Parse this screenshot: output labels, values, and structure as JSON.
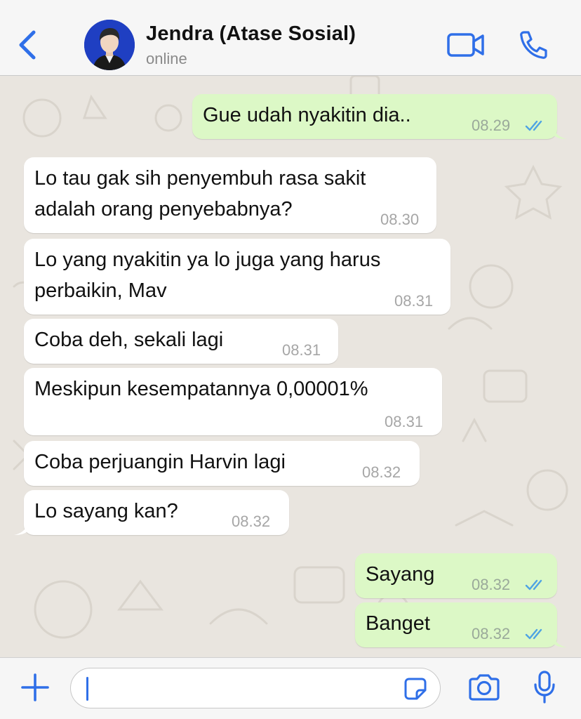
{
  "header": {
    "contact_name": "Jendra (Atase Sosial)",
    "contact_status": "online",
    "icons": {
      "back": "chevron-left-icon",
      "video": "video-camera-icon",
      "call": "phone-icon"
    },
    "accent_color": "#2f6fe8"
  },
  "messages": [
    {
      "direction": "outgoing",
      "lines": [
        "Gue udah nyakitin dia.."
      ],
      "time": "08.29",
      "status": "read"
    },
    {
      "direction": "incoming",
      "lines": [
        "Lo tau gak sih penyembuh rasa sakit",
        "adalah orang penyebabnya?"
      ],
      "time": "08.30"
    },
    {
      "direction": "incoming",
      "lines": [
        "Lo yang nyakitin ya lo juga yang harus",
        "perbaikin, Mav"
      ],
      "time": "08.31"
    },
    {
      "direction": "incoming",
      "lines": [
        "Coba deh, sekali lagi"
      ],
      "time": "08.31"
    },
    {
      "direction": "incoming",
      "lines": [
        "Meskipun kesempatannya 0,00001%"
      ],
      "time": "08.31"
    },
    {
      "direction": "incoming",
      "lines": [
        "Coba perjuangin Harvin lagi"
      ],
      "time": "08.32"
    },
    {
      "direction": "incoming",
      "lines": [
        "Lo sayang kan?"
      ],
      "time": "08.32"
    },
    {
      "direction": "outgoing",
      "lines": [
        "Sayang"
      ],
      "time": "08.32",
      "status": "read"
    },
    {
      "direction": "outgoing",
      "lines": [
        "Banget"
      ],
      "time": "08.32",
      "status": "read"
    }
  ],
  "composer": {
    "value": "",
    "icons": {
      "add": "plus-icon",
      "sticker": "sticker-icon",
      "camera": "camera-icon",
      "mic": "microphone-icon"
    }
  },
  "colors": {
    "incoming_bubble": "#ffffff",
    "outgoing_bubble": "#dcf8c6",
    "read_ticks": "#4fa3e3",
    "wallpaper": "#e9e5df"
  }
}
